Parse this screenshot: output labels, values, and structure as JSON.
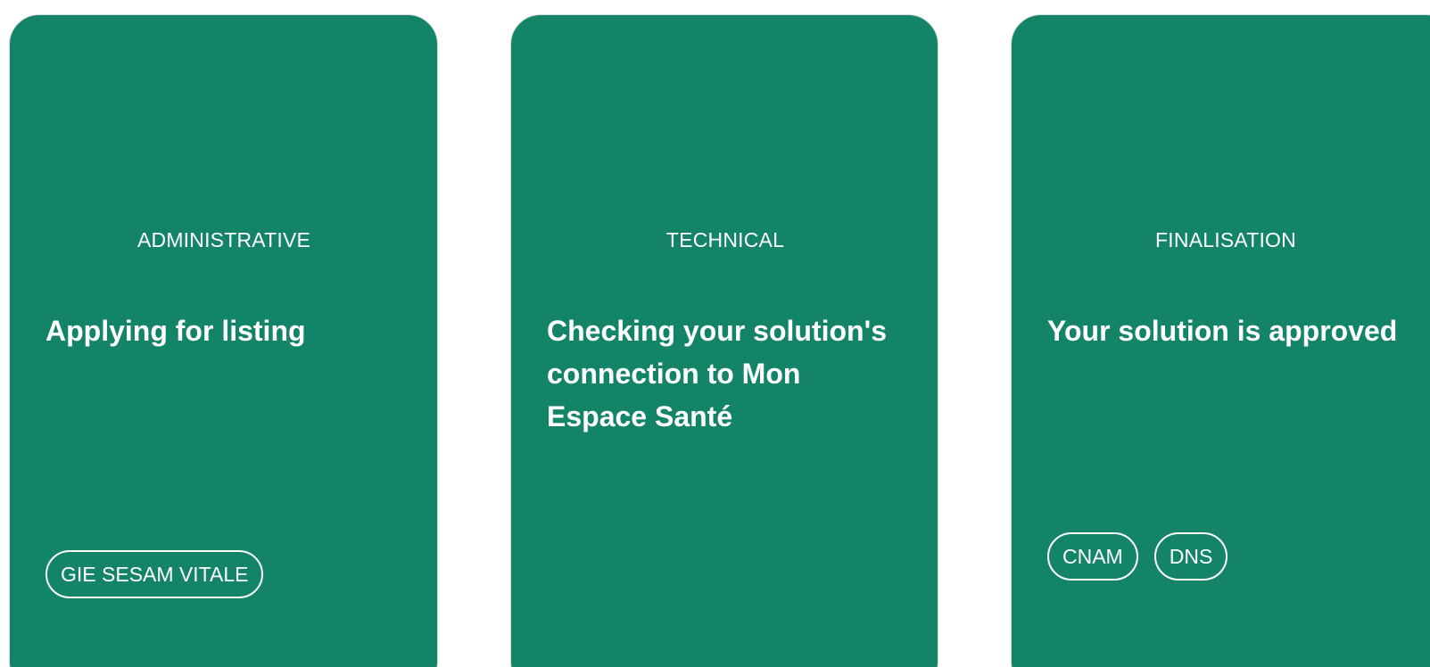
{
  "theme": {
    "card_color": "#138468",
    "text_color": "#ffffff"
  },
  "cards": [
    {
      "category": "ADMINISTRATIVE",
      "title": "Applying for listing",
      "tags": [
        "GIE SESAM VITALE"
      ]
    },
    {
      "category": "TECHNICAL",
      "title": "Checking your solution's connection to Mon Espace Santé",
      "tags": []
    },
    {
      "category": "FINALISATION",
      "title": "Your solution is approved",
      "tags": [
        "CNAM",
        "DNS"
      ]
    }
  ]
}
